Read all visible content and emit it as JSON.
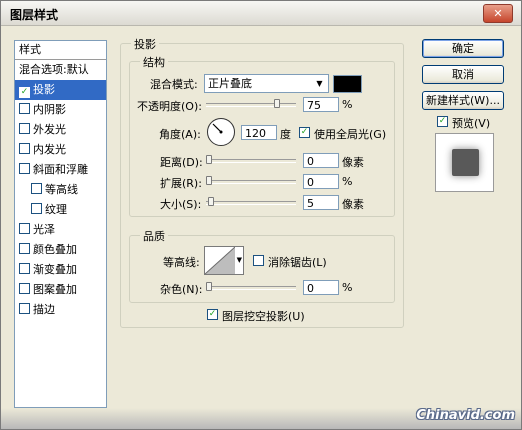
{
  "window": {
    "title": "图层样式",
    "close_glyph": "✕"
  },
  "sidebar": {
    "header": "样式",
    "items": [
      {
        "label": "混合选项:默认",
        "checkbox": false,
        "checked": false,
        "selected": false,
        "sub": false
      },
      {
        "label": "投影",
        "checkbox": true,
        "checked": true,
        "selected": true,
        "sub": false
      },
      {
        "label": "内阴影",
        "checkbox": true,
        "checked": false,
        "selected": false,
        "sub": false
      },
      {
        "label": "外发光",
        "checkbox": true,
        "checked": false,
        "selected": false,
        "sub": false
      },
      {
        "label": "内发光",
        "checkbox": true,
        "checked": false,
        "selected": false,
        "sub": false
      },
      {
        "label": "斜面和浮雕",
        "checkbox": true,
        "checked": false,
        "selected": false,
        "sub": false
      },
      {
        "label": "等高线",
        "checkbox": true,
        "checked": false,
        "selected": false,
        "sub": true
      },
      {
        "label": "纹理",
        "checkbox": true,
        "checked": false,
        "selected": false,
        "sub": true
      },
      {
        "label": "光泽",
        "checkbox": true,
        "checked": false,
        "selected": false,
        "sub": false
      },
      {
        "label": "颜色叠加",
        "checkbox": true,
        "checked": false,
        "selected": false,
        "sub": false
      },
      {
        "label": "渐变叠加",
        "checkbox": true,
        "checked": false,
        "selected": false,
        "sub": false
      },
      {
        "label": "图案叠加",
        "checkbox": true,
        "checked": false,
        "selected": false,
        "sub": false
      },
      {
        "label": "描边",
        "checkbox": true,
        "checked": false,
        "selected": false,
        "sub": false
      }
    ]
  },
  "drop_shadow": {
    "group_label": "投影",
    "structure": {
      "group_label": "结构",
      "blend_mode_label": "混合模式:",
      "blend_mode_value": "正片叠底",
      "blend_color": "#000000",
      "opacity_label": "不透明度(O):",
      "opacity_value": "75",
      "opacity_unit": "%",
      "opacity_level": 75,
      "angle_label": "角度(A):",
      "angle_value": "120",
      "angle_unit": "度",
      "global_light_label": "使用全局光(G)",
      "global_light_checked": true,
      "distance_label": "距离(D):",
      "distance_value": "0",
      "distance_unit": "像素",
      "spread_label": "扩展(R):",
      "spread_value": "0",
      "spread_unit": "%",
      "size_label": "大小(S):",
      "size_value": "5",
      "size_unit": "像素"
    },
    "quality": {
      "group_label": "品质",
      "contour_label": "等高线:",
      "anti_alias_label": "消除锯齿(L)",
      "anti_alias_checked": false,
      "noise_label": "杂色(N):",
      "noise_value": "0",
      "noise_unit": "%"
    },
    "knockout_label": "图层挖空投影(U)",
    "knockout_checked": true
  },
  "buttons": {
    "ok": "确定",
    "cancel": "取消",
    "new_style": "新建样式(W)..."
  },
  "preview": {
    "label": "预览(V)",
    "checked": true
  },
  "watermark": "Chinavid.com"
}
